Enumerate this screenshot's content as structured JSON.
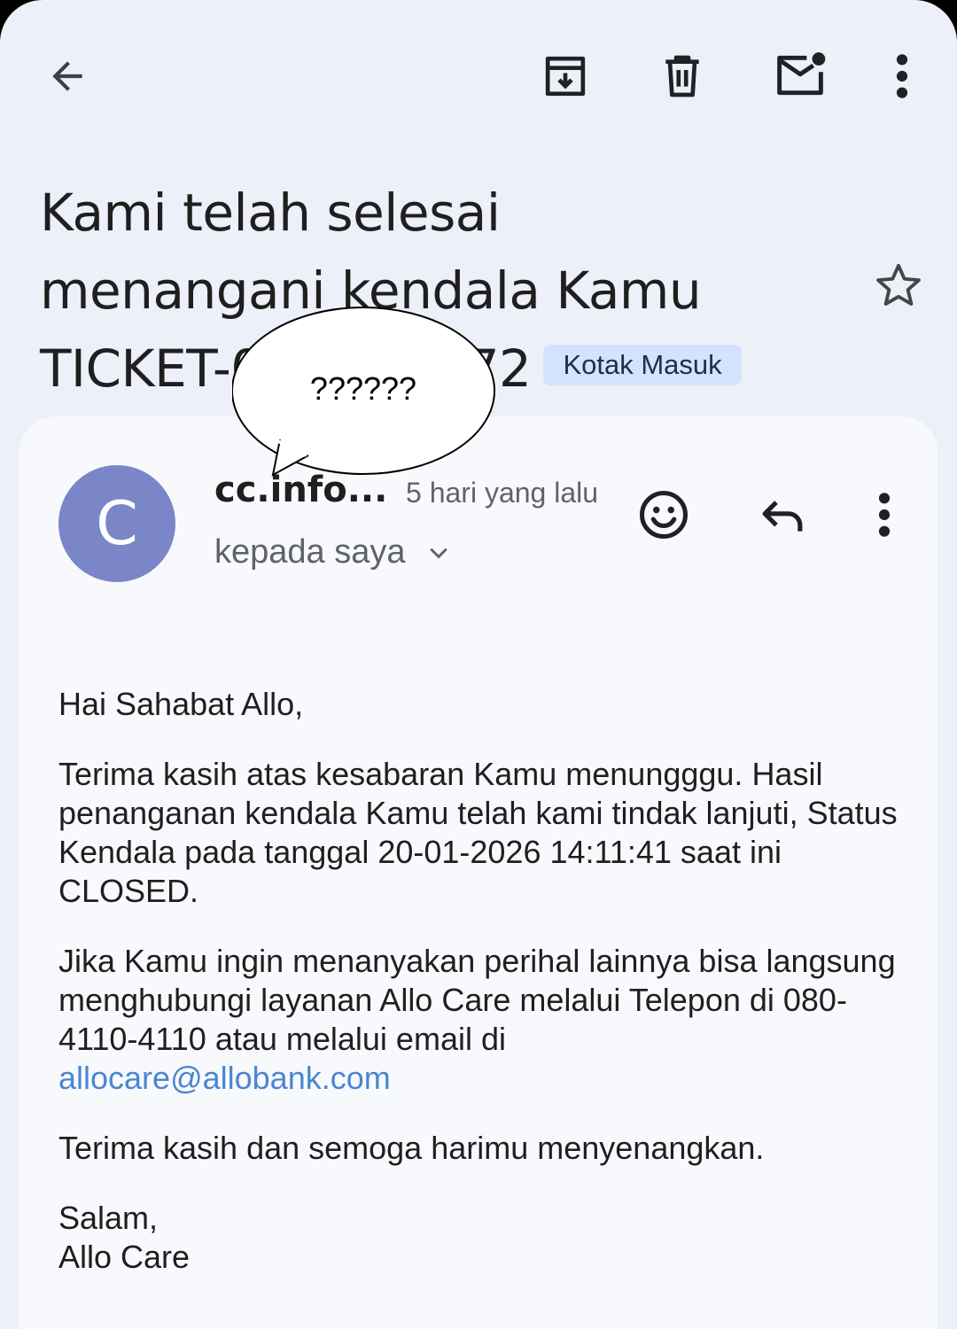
{
  "toolbar": {
    "back_icon": "arrow-back-icon",
    "archive_icon": "archive-icon",
    "delete_icon": "trash-icon",
    "mark_unread_icon": "mail-unread-icon",
    "more_icon": "more-vert-icon"
  },
  "email": {
    "subject_line1": "Kami telah selesai",
    "subject_line2": "menangani kendala Kamu",
    "subject_line3": "TICKET-0",
    "subject_line3_end": "72",
    "label": "Kotak Masuk",
    "sender_initial": "C",
    "sender": "cc.info...",
    "time": "5 hari yang lalu",
    "recipient": "kepada saya"
  },
  "overlay": {
    "bubble_text": "??????"
  },
  "body": {
    "greeting": "Hai Sahabat Allo,",
    "para1": "Terima kasih atas kesabaran Kamu menungggu. Hasil penanganan kendala Kamu telah kami tindak lanjuti, Status Kendala pada tanggal 20-01-2026 14:11:41 saat ini CLOSED.",
    "para2": "Jika Kamu ingin menanyakan perihal lainnya bisa langsung menghubungi layanan Allo Care melalui Telepon di 080-4110-4110 atau melalui email di",
    "email_link": "allocare@allobank.com",
    "para3": "Terima kasih dan semoga harimu menyenangkan.",
    "closing": "Salam,",
    "signature": "Allo Care"
  },
  "colors": {
    "background": "#edf0f9",
    "card": "#f8f9fd",
    "avatar": "#7b86c8",
    "label_chip": "#d3e3fd",
    "link": "#4a86d0"
  }
}
